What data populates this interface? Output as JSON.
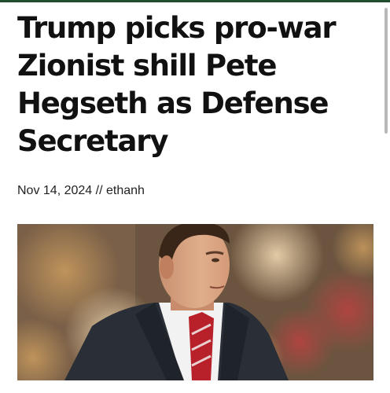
{
  "article": {
    "headline": "Trump picks pro-war Zionist shill Pete Hegseth as Defense Secretary",
    "date": "Nov 14, 2024",
    "separator": "//",
    "author": "ethanh"
  },
  "colors": {
    "top_bar": "#1f4d2e",
    "headline_text": "#111111",
    "byline_text": "#222222"
  },
  "icons": {
    "hero_image": "photo-of-man-in-suit-and-red-tie"
  }
}
